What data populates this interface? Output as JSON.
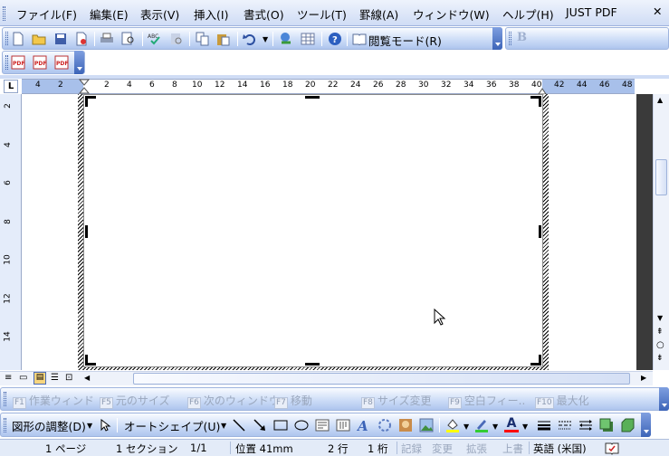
{
  "menubar": {
    "items": [
      "ファイル(F)",
      "編集(E)",
      "表示(V)",
      "挿入(I)",
      "書式(O)",
      "ツール(T)",
      "罫線(A)",
      "ウィンドウ(W)",
      "ヘルプ(H)",
      "JUST PDF"
    ],
    "close_glyph": "✕"
  },
  "standard_toolbar": {
    "icons": [
      "new-document-icon",
      "open-folder-icon",
      "save-icon",
      "permission-icon",
      "print-icon",
      "print-preview-icon",
      "spelling-icon",
      "research-icon",
      "copy-icon",
      "paste-icon",
      "undo-icon",
      "hyperlink-icon",
      "table-icon",
      "help-icon"
    ],
    "reading_mode_label": "閲覧モード(R)"
  },
  "formatting_toolbar": {
    "bold_label": "B"
  },
  "pdf_toolbar": {
    "icons": [
      "pdf-create-icon",
      "pdf-mail-icon",
      "pdf-settings-icon"
    ]
  },
  "ruler": {
    "tab_selector": "L",
    "h_labels": [
      "4",
      "2",
      "2",
      "4",
      "6",
      "8",
      "10",
      "12",
      "14",
      "16",
      "18",
      "20",
      "22",
      "24",
      "26",
      "28",
      "30",
      "32",
      "34",
      "36",
      "38",
      "40",
      "42",
      "44",
      "46",
      "48"
    ],
    "v_labels": [
      "2",
      "4",
      "6",
      "8",
      "10",
      "12",
      "14"
    ]
  },
  "fkeys": [
    {
      "key": "F1",
      "label": "作業ウィンド"
    },
    {
      "key": "F5",
      "label": "元のサイズ"
    },
    {
      "key": "F6",
      "label": "次のウィンドウ"
    },
    {
      "key": "F7",
      "label": "移動"
    },
    {
      "key": "F8",
      "label": "サイズ変更"
    },
    {
      "key": "F9",
      "label": "空白フィー.."
    },
    {
      "key": "F10",
      "label": "最大化"
    }
  ],
  "drawing_toolbar": {
    "adjust_label": "図形の調整(D)",
    "autoshape_label": "オートシェイプ(U)",
    "fill_color": "#ffff00",
    "line_color": "#33cc33",
    "font_color": "#ff0000",
    "font_color_letter": "A"
  },
  "status_bar": {
    "page": "1 ページ",
    "section": "1 セクション",
    "page_of": "1/1",
    "position": "位置 41mm",
    "line": "2 行",
    "column": "1 桁",
    "rec": "記録",
    "trk": "変更",
    "ext": "拡張",
    "ovr": "上書",
    "language": "英語 (米国)"
  },
  "colors": {
    "toolbar_accent": "#3c64b8",
    "ruler_margin": "#a8c0ea"
  }
}
